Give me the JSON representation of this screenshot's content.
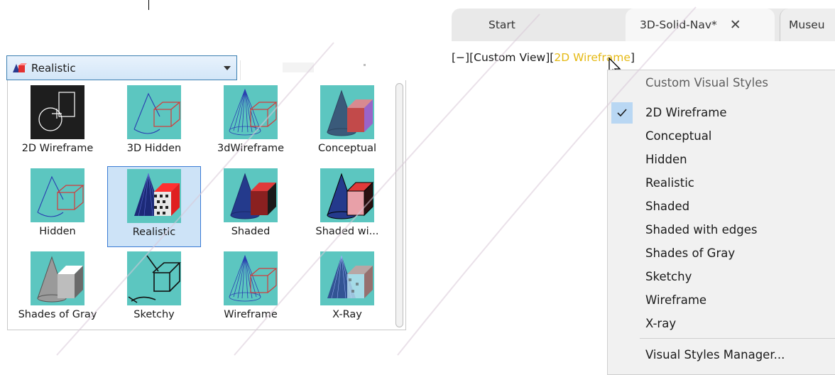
{
  "style_dropdown": {
    "selected": "Realistic",
    "icon": "realistic-style-icon"
  },
  "gallery": {
    "items": [
      {
        "label": "2D Wireframe",
        "icon": "2d-wireframe-icon",
        "selected": false
      },
      {
        "label": "3D Hidden",
        "icon": "3d-hidden-icon",
        "selected": false
      },
      {
        "label": "3dWireframe",
        "icon": "3d-wireframe-icon",
        "selected": false
      },
      {
        "label": "Conceptual",
        "icon": "conceptual-icon",
        "selected": false
      },
      {
        "label": "Hidden",
        "icon": "hidden-icon",
        "selected": false
      },
      {
        "label": "Realistic",
        "icon": "realistic-icon",
        "selected": true
      },
      {
        "label": "Shaded",
        "icon": "shaded-icon",
        "selected": false
      },
      {
        "label": "Shaded wi...",
        "icon": "shaded-with-edges-icon",
        "selected": false
      },
      {
        "label": "Shades of Gray",
        "icon": "shades-of-gray-icon",
        "selected": false
      },
      {
        "label": "Sketchy",
        "icon": "sketchy-icon",
        "selected": false
      },
      {
        "label": "Wireframe",
        "icon": "wireframe-icon",
        "selected": false
      },
      {
        "label": "X-Ray",
        "icon": "x-ray-icon",
        "selected": false
      }
    ]
  },
  "tabs": {
    "start": "Start",
    "active": "3D-Solid-Nav*",
    "close_icon": "close-icon",
    "third": "Museu"
  },
  "viewport": {
    "minus": "[−]",
    "view": "[Custom View]",
    "style_open": "[",
    "style": "2D Wireframe",
    "style_close": "]"
  },
  "menu": {
    "header": "Custom Visual Styles",
    "items": [
      {
        "label": "2D Wireframe",
        "checked": true
      },
      {
        "label": "Conceptual",
        "checked": false
      },
      {
        "label": "Hidden",
        "checked": false
      },
      {
        "label": "Realistic",
        "checked": false
      },
      {
        "label": "Shaded",
        "checked": false
      },
      {
        "label": "Shaded with edges",
        "checked": false
      },
      {
        "label": "Shades of Gray",
        "checked": false
      },
      {
        "label": "Sketchy",
        "checked": false
      },
      {
        "label": "Wireframe",
        "checked": false
      },
      {
        "label": "X-ray",
        "checked": false
      }
    ],
    "manager": "Visual Styles Manager..."
  },
  "colors": {
    "thumb_bg": "#5cc6c0",
    "selection_bg": "#cde3f7",
    "selection_border": "#3b7bd4",
    "check_bg": "#b9d7f3",
    "viewport_style": "#e5b913"
  }
}
